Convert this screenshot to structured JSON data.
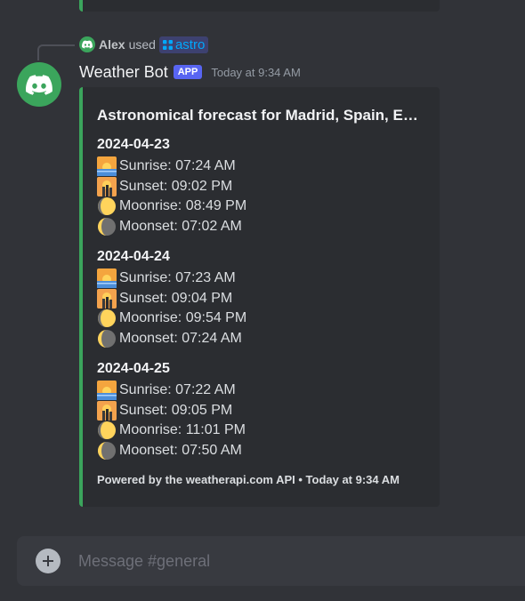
{
  "interaction": {
    "user": "Alex",
    "verb": "used",
    "command": "astro"
  },
  "message": {
    "author": "Weather Bot",
    "badge": "APP",
    "timestamp": "Today at 9:34 AM"
  },
  "embed": {
    "title": "Astronomical forecast for Madrid, Spain, Europe",
    "accent_color": "#3ba55c",
    "days": [
      {
        "date": "2024-04-23",
        "entries": [
          {
            "icon": "sunrise-icon",
            "text": "Sunrise: 07:24 AM"
          },
          {
            "icon": "sunset-icon",
            "text": "Sunset: 09:02 PM"
          },
          {
            "icon": "moonrise-icon",
            "text": "Moonrise: 08:49 PM"
          },
          {
            "icon": "moonset-icon",
            "text": "Moonset: 07:02 AM"
          }
        ]
      },
      {
        "date": "2024-04-24",
        "entries": [
          {
            "icon": "sunrise-icon",
            "text": "Sunrise: 07:23 AM"
          },
          {
            "icon": "sunset-icon",
            "text": "Sunset: 09:04 PM"
          },
          {
            "icon": "moonrise-icon",
            "text": "Moonrise: 09:54 PM"
          },
          {
            "icon": "moonset-icon",
            "text": "Moonset: 07:24 AM"
          }
        ]
      },
      {
        "date": "2024-04-25",
        "entries": [
          {
            "icon": "sunrise-icon",
            "text": "Sunrise: 07:22 AM"
          },
          {
            "icon": "sunset-icon",
            "text": "Sunset: 09:05 PM"
          },
          {
            "icon": "moonrise-icon",
            "text": "Moonrise: 11:01 PM"
          },
          {
            "icon": "moonset-icon",
            "text": "Moonset: 07:50 AM"
          }
        ]
      }
    ],
    "footer": "Powered by the weatherapi.com API • Today at 9:34 AM"
  },
  "composer": {
    "placeholder": "Message #general"
  }
}
